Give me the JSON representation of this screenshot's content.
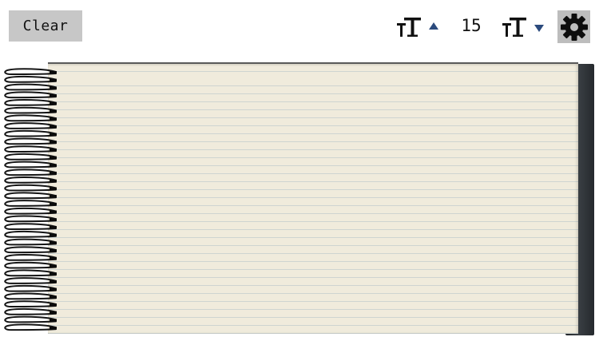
{
  "toolbar": {
    "clear_label": "Clear",
    "font_size_value": "15"
  },
  "icons": {
    "increase_font": "font-size-increase-icon",
    "decrease_font": "font-size-decrease-icon",
    "settings": "gear-icon"
  },
  "colors": {
    "button_bg": "#c7c7c7",
    "arrow": "#2b4a7d",
    "paper": "#f0ebdc",
    "paper_lines": "#a9bccd",
    "cover": "#2c3034"
  }
}
